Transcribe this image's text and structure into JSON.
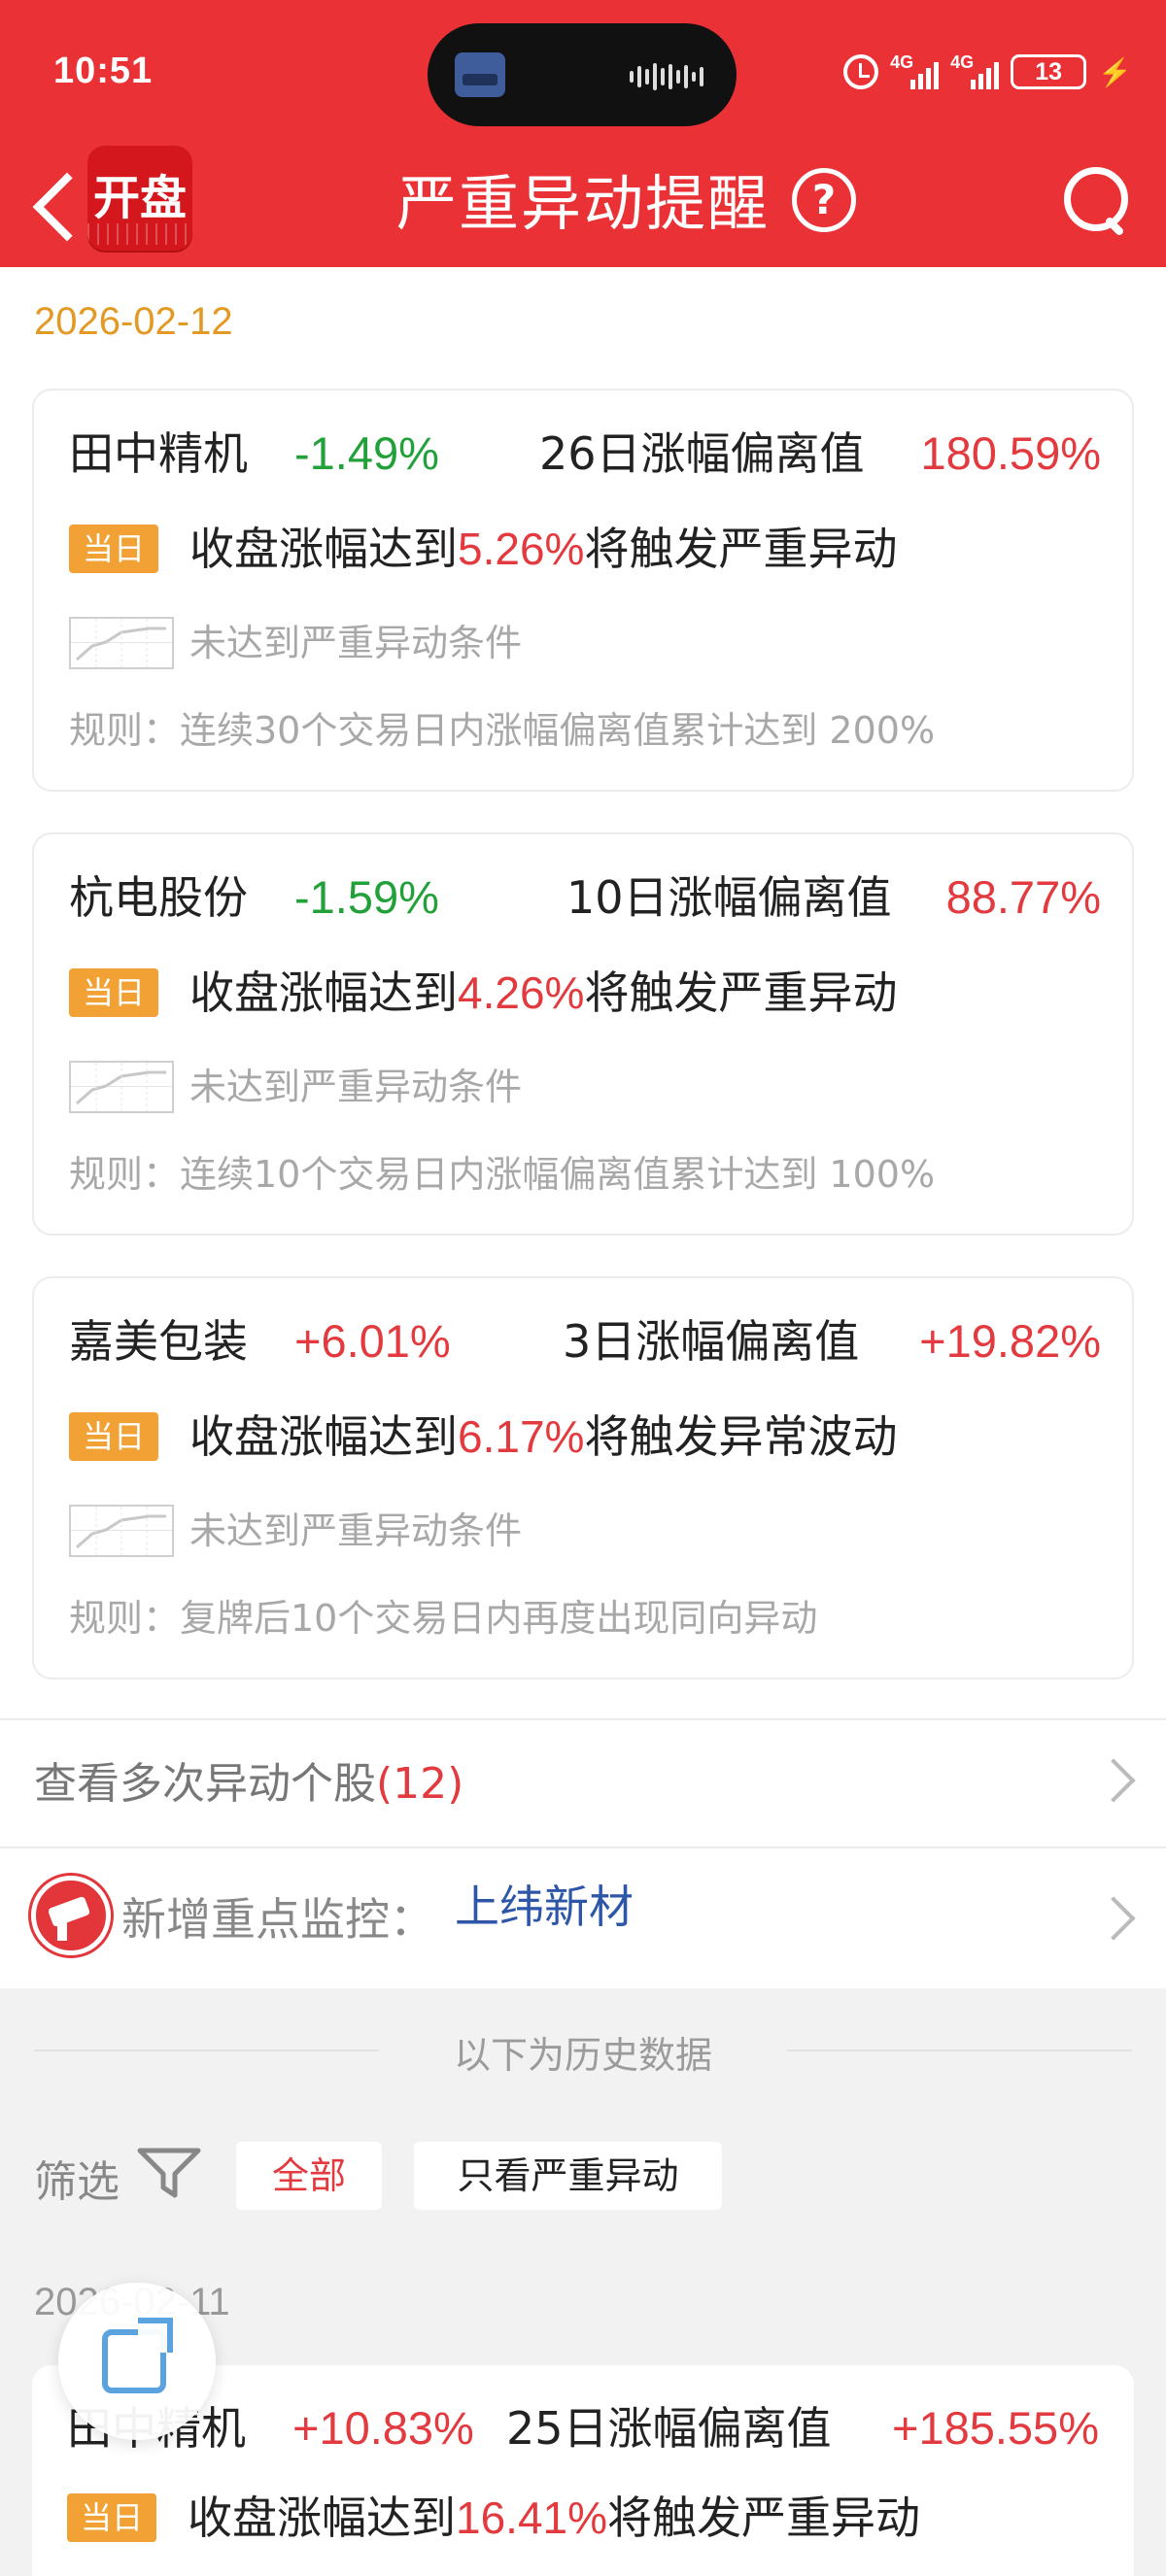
{
  "status_bar": {
    "time": "10:51",
    "net1": "4G",
    "net2": "4G",
    "battery": "13"
  },
  "header": {
    "logo_text": "开盘",
    "title": "严重异动提醒",
    "help": "?"
  },
  "today": {
    "date": "2026-02-12",
    "cards": [
      {
        "name": "田中精机",
        "change": "-1.49%",
        "metric": "26日涨幅偏离值",
        "metric_value": "180.59%",
        "tag": "当日",
        "trigger_prefix": "收盘涨幅达到",
        "trigger_pct": "5.26%",
        "trigger_suffix": "将触发严重异动",
        "status": "未达到严重异动条件",
        "rule": "规则：连续30个交易日内涨幅偏离值累计达到 200%"
      },
      {
        "name": "杭电股份",
        "change": "-1.59%",
        "metric": "10日涨幅偏离值",
        "metric_value": "88.77%",
        "tag": "当日",
        "trigger_prefix": "收盘涨幅达到",
        "trigger_pct": "4.26%",
        "trigger_suffix": "将触发严重异动",
        "status": "未达到严重异动条件",
        "rule": "规则：连续10个交易日内涨幅偏离值累计达到 100%"
      },
      {
        "name": "嘉美包装",
        "change": "+6.01%",
        "metric": "3日涨幅偏离值",
        "metric_value": "+19.82%",
        "tag": "当日",
        "trigger_prefix": "收盘涨幅达到",
        "trigger_pct": "6.17%",
        "trigger_suffix": "将触发异常波动",
        "status": "未达到严重异动条件",
        "rule": "规则：复牌后10个交易日内再度出现同向异动"
      }
    ]
  },
  "multi_link": {
    "label": "查看多次异动个股",
    "count": "(12)"
  },
  "watch": {
    "label": "新增重点监控：",
    "stock": "上纬新材"
  },
  "history": {
    "title": "以下为历史数据",
    "filter_label": "筛选",
    "filter_all": "全部",
    "filter_serious": "只看严重异动",
    "date": "2026-02-11",
    "card": {
      "name": "田中精机",
      "change": "+10.83%",
      "metric": "25日涨幅偏离值",
      "metric_value": "+185.55%",
      "tag": "当日",
      "trigger_prefix": "收盘涨幅达到",
      "trigger_pct": "16.41%",
      "trigger_suffix": "将触发严重异动"
    }
  },
  "colors": {
    "brand_red": "#ea3236",
    "up": "#e23a3e",
    "down": "#22a13a",
    "tag": "#f2a134",
    "date": "#e39a24",
    "link": "#2e56a8"
  },
  "icons": [
    "back-icon",
    "help-icon",
    "search-icon",
    "trend-icon",
    "chevron-right-icon",
    "camera-icon",
    "filter-icon",
    "share-icon"
  ]
}
